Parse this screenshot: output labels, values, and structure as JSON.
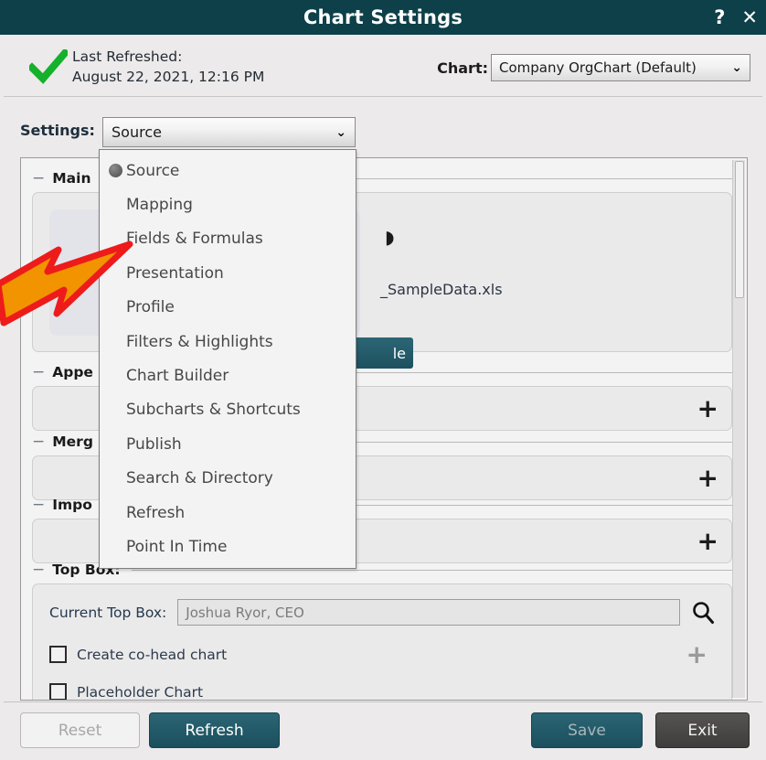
{
  "window": {
    "title": "Chart Settings",
    "help_icon": "?",
    "close_icon": "✕"
  },
  "status": {
    "check_icon": "green-check",
    "refreshed_label": "Last Refreshed:",
    "refreshed_time": "August 22, 2021, 12:16 PM",
    "chart_label": "Chart:",
    "chart_value": "Company OrgChart (Default)",
    "caret": "⌄"
  },
  "settings": {
    "label": "Settings:",
    "value": "Source",
    "caret": "⌄",
    "menu_items": [
      {
        "label": "Source",
        "selected": true
      },
      {
        "label": "Mapping",
        "selected": false
      },
      {
        "label": "Fields & Formulas",
        "selected": false
      },
      {
        "label": "Presentation",
        "selected": false
      },
      {
        "label": "Profile",
        "selected": false
      },
      {
        "label": "Filters & Highlights",
        "selected": false
      },
      {
        "label": "Chart Builder",
        "selected": false
      },
      {
        "label": "Subcharts & Shortcuts",
        "selected": false
      },
      {
        "label": "Publish",
        "selected": false
      },
      {
        "label": "Search & Directory",
        "selected": false
      },
      {
        "label": "Refresh",
        "selected": false
      },
      {
        "label": "Point In Time",
        "selected": false
      }
    ]
  },
  "sections": {
    "main": {
      "label": "Main",
      "collapse_icon": "−",
      "source_file": "_SampleData.xls",
      "glyph": "◗",
      "button_label": "le"
    },
    "appearance": {
      "label": "Appe",
      "collapse_icon": "−",
      "expand_icon": "+"
    },
    "merge": {
      "label": "Merg",
      "collapse_icon": "−",
      "expand_icon": "+"
    },
    "import": {
      "label": "Impo",
      "collapse_icon": "−",
      "expand_icon": "+"
    },
    "topbox": {
      "label": "Top Box:",
      "collapse_icon": "−",
      "current_label": "Current Top Box:",
      "current_value": "Joshua Ryor, CEO",
      "search_icon": "search-icon",
      "checkbox_cohead": "Create co-head chart",
      "checkbox_cohead_checked": false,
      "add_icon": "+",
      "checkbox_placeholder": "Placeholder Chart",
      "checkbox_placeholder_checked": false
    }
  },
  "footer": {
    "reset": "Reset",
    "refresh": "Refresh",
    "save": "Save",
    "exit": "Exit"
  },
  "colors": {
    "titlebar_teal": "#0d4049",
    "button_teal": "#1d5160",
    "exit_gray": "#474544",
    "check_green": "#16b02c",
    "arrow_fill": "#f29400",
    "arrow_stroke": "#ee1b1b"
  }
}
